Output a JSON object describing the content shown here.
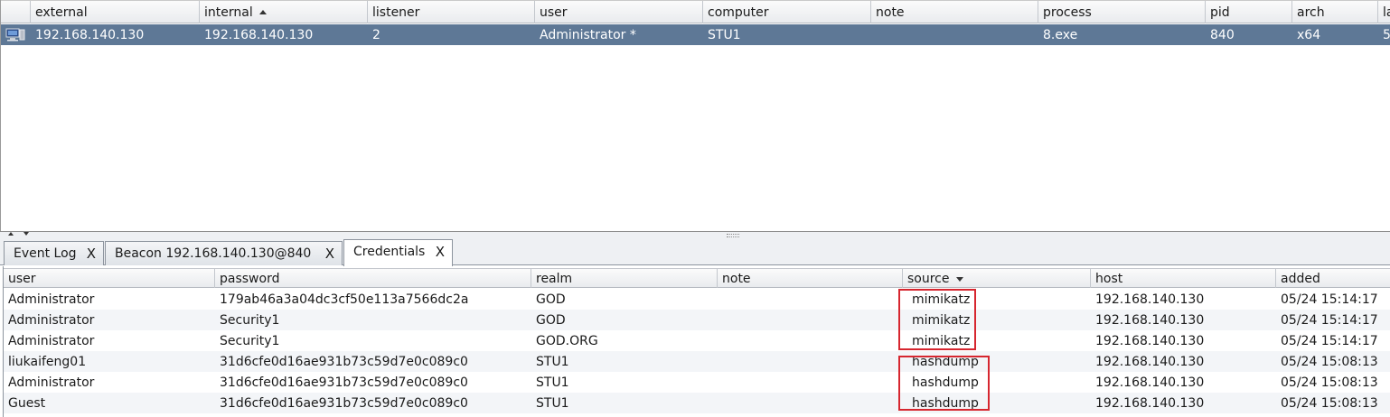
{
  "beacons": {
    "columns": [
      {
        "label": "",
        "sort": ""
      },
      {
        "label": "external",
        "sort": ""
      },
      {
        "label": "internal",
        "sort": "asc"
      },
      {
        "label": "listener",
        "sort": ""
      },
      {
        "label": "user",
        "sort": ""
      },
      {
        "label": "computer",
        "sort": ""
      },
      {
        "label": "note",
        "sort": ""
      },
      {
        "label": "process",
        "sort": ""
      },
      {
        "label": "pid",
        "sort": ""
      },
      {
        "label": "arch",
        "sort": ""
      },
      {
        "label": "la",
        "sort": ""
      }
    ],
    "rows": [
      {
        "icon": "beacon-computer-icon",
        "external": "192.168.140.130",
        "internal": "192.168.140.130",
        "listener": "2",
        "user": "Administrator *",
        "computer": "STU1",
        "note": "",
        "process": "8.exe",
        "pid": "840",
        "arch": "x64",
        "last": "5"
      }
    ]
  },
  "tabs": [
    {
      "label": "Event Log",
      "close": "X",
      "active": false
    },
    {
      "label": "Beacon 192.168.140.130@840",
      "close": "X",
      "active": false
    },
    {
      "label": "Credentials",
      "close": "X",
      "active": true
    }
  ],
  "credentials": {
    "columns": [
      {
        "label": "user",
        "sort": ""
      },
      {
        "label": "password",
        "sort": ""
      },
      {
        "label": "realm",
        "sort": ""
      },
      {
        "label": "note",
        "sort": ""
      },
      {
        "label": "source",
        "sort": "desc"
      },
      {
        "label": "host",
        "sort": ""
      },
      {
        "label": "added",
        "sort": ""
      }
    ],
    "rows": [
      {
        "user": "Administrator",
        "password": "179ab46a3a04dc3cf50e113a7566dc2a",
        "realm": "GOD",
        "note": "",
        "source": "mimikatz",
        "host": "192.168.140.130",
        "added": "05/24 15:14:17"
      },
      {
        "user": "Administrator",
        "password": "Security1",
        "realm": "GOD",
        "note": "",
        "source": "mimikatz",
        "host": "192.168.140.130",
        "added": "05/24 15:14:17"
      },
      {
        "user": "Administrator",
        "password": "Security1",
        "realm": "GOD.ORG",
        "note": "",
        "source": "mimikatz",
        "host": "192.168.140.130",
        "added": "05/24 15:14:17"
      },
      {
        "user": "liukaifeng01",
        "password": "31d6cfe0d16ae931b73c59d7e0c089c0",
        "realm": "STU1",
        "note": "",
        "source": "hashdump",
        "host": "192.168.140.130",
        "added": "05/24 15:08:13"
      },
      {
        "user": "Administrator",
        "password": "31d6cfe0d16ae931b73c59d7e0c089c0",
        "realm": "STU1",
        "note": "",
        "source": "hashdump",
        "host": "192.168.140.130",
        "added": "05/24 15:08:13"
      },
      {
        "user": "Guest",
        "password": "31d6cfe0d16ae931b73c59d7e0c089c0",
        "realm": "STU1",
        "note": "",
        "source": "hashdump",
        "host": "192.168.140.130",
        "added": "05/24 15:08:13"
      }
    ]
  },
  "colors": {
    "selected_row": "#5e7896",
    "highlight_box": "#d6262f"
  }
}
